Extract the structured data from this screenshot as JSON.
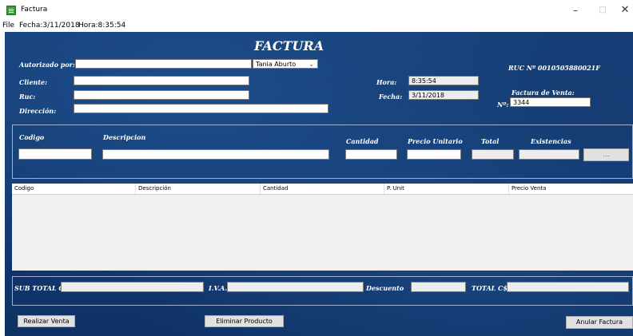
{
  "window": {
    "title": "Factura",
    "minimize": "–",
    "maximize": "□",
    "close": "✕",
    "icon": "app-form-icon"
  },
  "menu": {
    "file": "File",
    "fecha": "Fecha:3/11/2018",
    "hora": "Hora:8:35:54"
  },
  "form": {
    "title": "FACTURA",
    "ruc": "RUC Nº 0010505880021F",
    "autorizado_label": "Autorizado por:",
    "autorizado_value": "",
    "autorizado_select": "Tania Aburto",
    "cliente_label": "Cliente:",
    "ruc_label": "Ruc:",
    "direccion_label": "Dirección:",
    "hora_label": "Hora:",
    "hora_value": "8:35:54",
    "fecha_label": "Fecha:",
    "fecha_value": "3/11/2018",
    "factura_venta_label": "Factura de Venta:",
    "numero_label": "Nº:",
    "numero_value": "3344"
  },
  "product": {
    "codigo_label": "Codigo",
    "descripcion_label": "Descripcion",
    "cantidad_label": "Cantidad",
    "precio_unitario_label": "Precio Unitario",
    "total_label": "Total",
    "existencias_label": "Existencias",
    "browse_button": "..."
  },
  "grid": {
    "columns": [
      "Codigo",
      "Descripción",
      "Cantidad",
      "P. Unit",
      "Precio Venta"
    ]
  },
  "totals": {
    "subtotal_label": "SUB TOTAL C$",
    "iva_label": "I.V.A.",
    "descuento_label": "Descuento",
    "total_label": "TOTAL C$"
  },
  "actions": {
    "realizar": "Realizar Venta",
    "eliminar": "Eliminar Producto",
    "anular": "Anular Factura"
  }
}
